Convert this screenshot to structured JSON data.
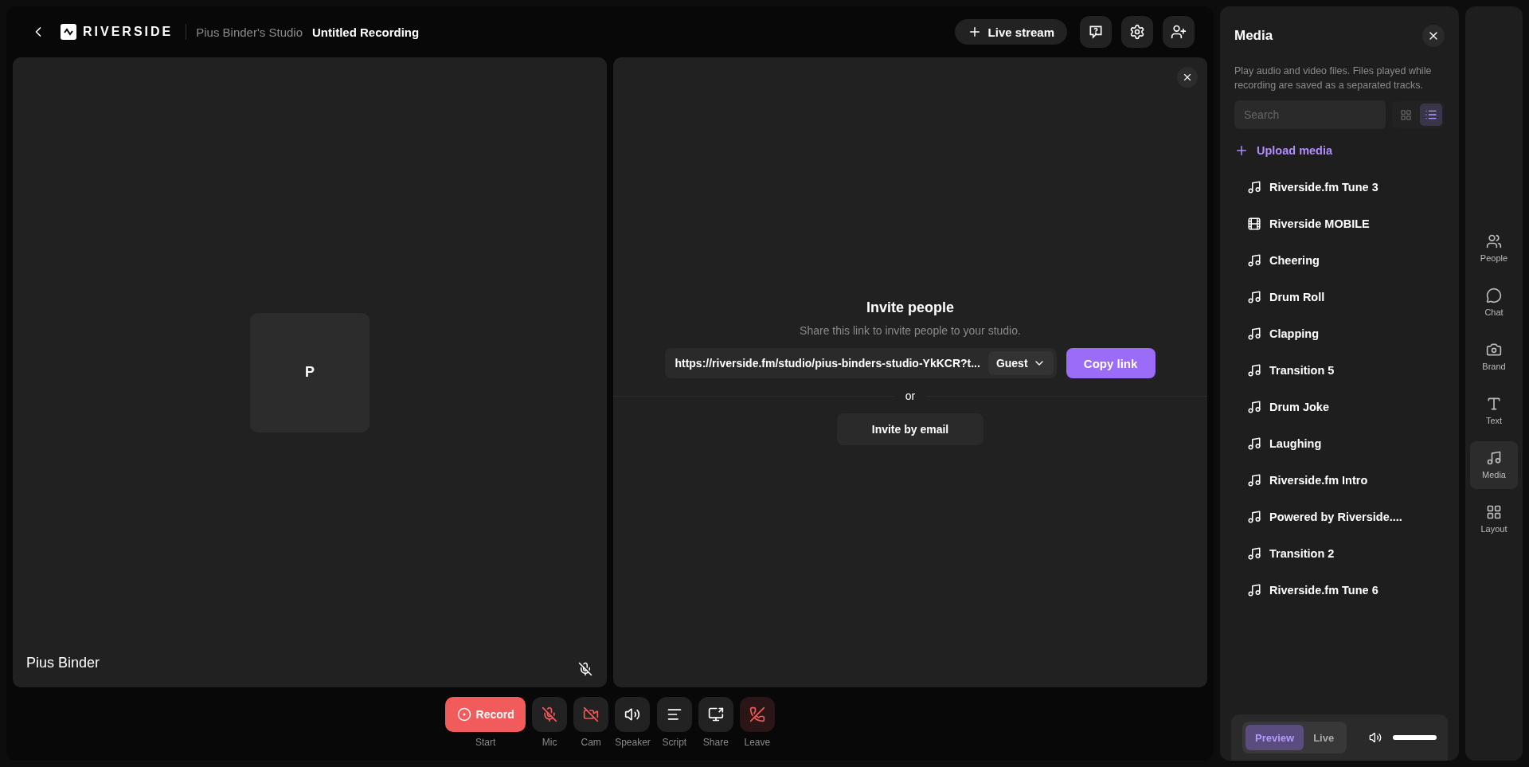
{
  "header": {
    "logo": "RIVERSIDE",
    "studio": "Pius Binder's Studio",
    "title": "Untitled Recording",
    "live_stream": "Live stream"
  },
  "participant": {
    "initial": "P",
    "name": "Pius Binder",
    "mic_muted": true
  },
  "invite": {
    "title": "Invite people",
    "subtitle": "Share this link to invite people to your studio.",
    "link": "https://riverside.fm/studio/pius-binders-studio-YkKCR?t...",
    "role": "Guest",
    "copy": "Copy link",
    "or": "or",
    "email": "Invite by email"
  },
  "controls": [
    {
      "kind": "record",
      "icon_label": "Record",
      "label": "Start"
    },
    {
      "kind": "mic",
      "label": "Mic",
      "on": false
    },
    {
      "kind": "cam",
      "label": "Cam",
      "on": false
    },
    {
      "kind": "speaker",
      "label": "Speaker"
    },
    {
      "kind": "script",
      "label": "Script"
    },
    {
      "kind": "share",
      "label": "Share"
    },
    {
      "kind": "leave",
      "label": "Leave"
    }
  ],
  "media": {
    "title": "Media",
    "description": "Play audio and video files. Files played while recording are saved as a separated tracks.",
    "search_placeholder": "Search",
    "views": [
      {
        "kind": "grid",
        "selected": false
      },
      {
        "kind": "list",
        "selected": true
      }
    ],
    "upload": "Upload media",
    "items": [
      {
        "kind": "audio",
        "name": "Riverside.fm Tune 3"
      },
      {
        "kind": "video",
        "name": "Riverside MOBILE"
      },
      {
        "kind": "audio",
        "name": "Cheering"
      },
      {
        "kind": "audio",
        "name": "Drum Roll"
      },
      {
        "kind": "audio",
        "name": "Clapping"
      },
      {
        "kind": "audio",
        "name": "Transition 5"
      },
      {
        "kind": "audio",
        "name": "Drum Joke"
      },
      {
        "kind": "audio",
        "name": "Laughing"
      },
      {
        "kind": "audio",
        "name": "Riverside.fm Intro"
      },
      {
        "kind": "audio",
        "name": "Powered by Riverside...."
      },
      {
        "kind": "audio",
        "name": "Transition 2"
      },
      {
        "kind": "audio",
        "name": "Riverside.fm Tune 6"
      }
    ],
    "modes": [
      {
        "label": "Preview",
        "selected": true
      },
      {
        "label": "Live",
        "selected": false
      }
    ],
    "volume": {
      "level": 1
    }
  },
  "rail": [
    {
      "kind": "people",
      "label": "People",
      "selected": false
    },
    {
      "kind": "chat",
      "label": "Chat",
      "selected": false
    },
    {
      "kind": "brand",
      "label": "Brand",
      "selected": false
    },
    {
      "kind": "text",
      "label": "Text",
      "selected": false
    },
    {
      "kind": "media",
      "label": "Media",
      "selected": true
    },
    {
      "kind": "layout",
      "label": "Layout",
      "selected": false
    }
  ]
}
